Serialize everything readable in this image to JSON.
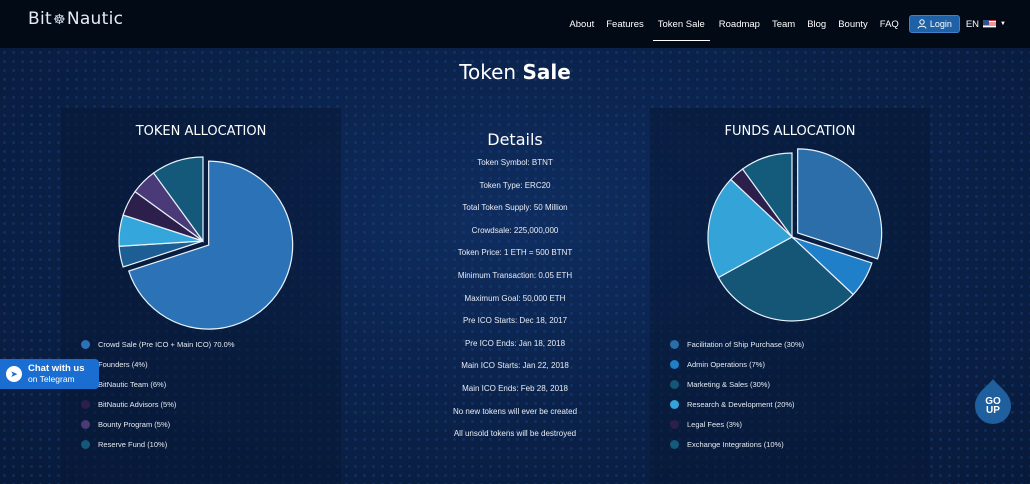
{
  "header": {
    "brand": "Bit Nautic",
    "brand_left": "Bit",
    "brand_right": "Nautic",
    "nav": [
      "About",
      "Features",
      "Token Sale",
      "Roadmap",
      "Team",
      "Blog",
      "Bounty",
      "FAQ"
    ],
    "active_nav": "Token Sale",
    "login_label": "Login",
    "language": "EN"
  },
  "page": {
    "title_light": "Token",
    "title_bold": "Sale"
  },
  "token_allocation": {
    "title": "TOKEN ALLOCATION",
    "legend": [
      {
        "label": "Crowd Sale (Pre ICO + Main ICO) 70.0%",
        "color": "#2b73b6"
      },
      {
        "label": "Founders (4%)",
        "color": "#1d5e94"
      },
      {
        "label": "BitNautic Team (6%)",
        "color": "#35a6dc"
      },
      {
        "label": "BitNautic Advisors (5%)",
        "color": "#2d1f4c"
      },
      {
        "label": "Bounty Program (5%)",
        "color": "#4a3a78"
      },
      {
        "label": "Reserve Fund (10%)",
        "color": "#14587a"
      }
    ]
  },
  "details": {
    "title": "Details",
    "items": [
      "Token Symbol: BTNT",
      "Token Type: ERC20",
      "Total Token Supply: 50 Million",
      "Crowdsale: 225,000,000",
      "Token Price: 1 ETH = 500 BTNT",
      "Minimum Transaction: 0.05 ETH",
      "Maximum Goal: 50,000 ETH",
      "Pre ICO Starts: Dec 18, 2017",
      "Pre ICO Ends: Jan 18, 2018",
      "Main ICO Starts: Jan 22, 2018",
      "Main ICO Ends: Feb 28, 2018",
      "No new tokens will ever be created",
      "All unsold tokens will be destroyed"
    ]
  },
  "funds_allocation": {
    "title": "FUNDS ALLOCATION",
    "legend": [
      {
        "label": "Facilitation of Ship Purchase (30%)",
        "color": "#2b6eaa"
      },
      {
        "label": "Admin Operations (7%)",
        "color": "#1f7fc8"
      },
      {
        "label": "Marketing & Sales (30%)",
        "color": "#155575"
      },
      {
        "label": "Research & Development (20%)",
        "color": "#33a3d8"
      },
      {
        "label": "Legal Fees (3%)",
        "color": "#2d1f4c"
      },
      {
        "label": "Exchange Integrations (10%)",
        "color": "#145a7b"
      }
    ]
  },
  "chat": {
    "line1": "Chat with us",
    "line2": "on Telegram"
  },
  "go_up": {
    "line1": "GO",
    "line2": "UP"
  },
  "chart_data": [
    {
      "type": "pie",
      "title": "TOKEN ALLOCATION",
      "categories": [
        "Crowd Sale (Pre ICO + Main ICO)",
        "Founders",
        "BitNautic Team",
        "BitNautic Advisors",
        "Bounty Program",
        "Reserve Fund"
      ],
      "values": [
        70,
        4,
        6,
        5,
        5,
        10
      ],
      "colors": [
        "#2b73b6",
        "#1d5e94",
        "#35a6dc",
        "#2d1f4c",
        "#4a3a78",
        "#14587a"
      ],
      "exploded": [
        0
      ]
    },
    {
      "type": "pie",
      "title": "FUNDS ALLOCATION",
      "categories": [
        "Facilitation of Ship Purchase",
        "Admin Operations",
        "Marketing & Sales",
        "Research & Development",
        "Legal Fees",
        "Exchange Integrations"
      ],
      "values": [
        30,
        7,
        30,
        20,
        3,
        10
      ],
      "colors": [
        "#2b6eaa",
        "#1f7fc8",
        "#155575",
        "#33a3d8",
        "#2d1f4c",
        "#145a7b"
      ],
      "exploded": [
        0
      ]
    }
  ]
}
